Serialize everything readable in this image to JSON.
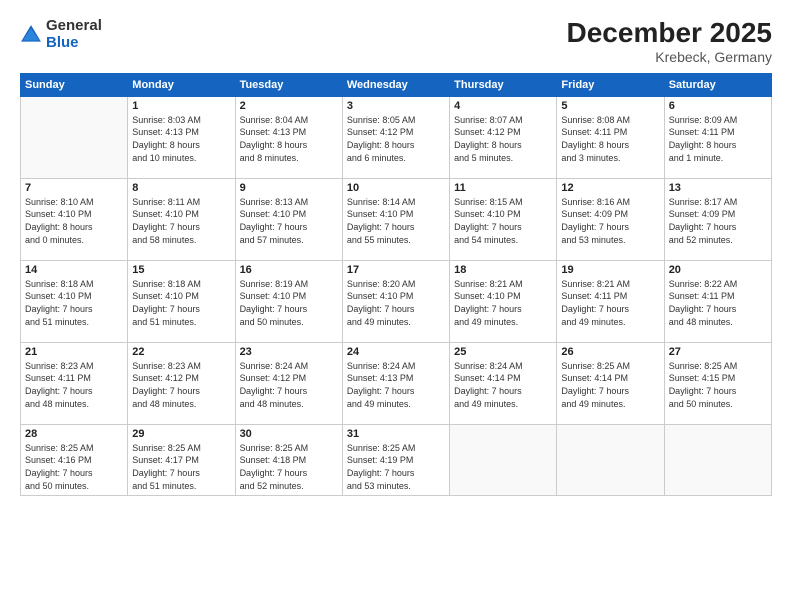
{
  "logo": {
    "general": "General",
    "blue": "Blue"
  },
  "title": "December 2025",
  "location": "Krebeck, Germany",
  "days_header": [
    "Sunday",
    "Monday",
    "Tuesday",
    "Wednesday",
    "Thursday",
    "Friday",
    "Saturday"
  ],
  "weeks": [
    [
      {
        "num": "",
        "info": ""
      },
      {
        "num": "1",
        "info": "Sunrise: 8:03 AM\nSunset: 4:13 PM\nDaylight: 8 hours\nand 10 minutes."
      },
      {
        "num": "2",
        "info": "Sunrise: 8:04 AM\nSunset: 4:13 PM\nDaylight: 8 hours\nand 8 minutes."
      },
      {
        "num": "3",
        "info": "Sunrise: 8:05 AM\nSunset: 4:12 PM\nDaylight: 8 hours\nand 6 minutes."
      },
      {
        "num": "4",
        "info": "Sunrise: 8:07 AM\nSunset: 4:12 PM\nDaylight: 8 hours\nand 5 minutes."
      },
      {
        "num": "5",
        "info": "Sunrise: 8:08 AM\nSunset: 4:11 PM\nDaylight: 8 hours\nand 3 minutes."
      },
      {
        "num": "6",
        "info": "Sunrise: 8:09 AM\nSunset: 4:11 PM\nDaylight: 8 hours\nand 1 minute."
      }
    ],
    [
      {
        "num": "7",
        "info": "Sunrise: 8:10 AM\nSunset: 4:10 PM\nDaylight: 8 hours\nand 0 minutes."
      },
      {
        "num": "8",
        "info": "Sunrise: 8:11 AM\nSunset: 4:10 PM\nDaylight: 7 hours\nand 58 minutes."
      },
      {
        "num": "9",
        "info": "Sunrise: 8:13 AM\nSunset: 4:10 PM\nDaylight: 7 hours\nand 57 minutes."
      },
      {
        "num": "10",
        "info": "Sunrise: 8:14 AM\nSunset: 4:10 PM\nDaylight: 7 hours\nand 55 minutes."
      },
      {
        "num": "11",
        "info": "Sunrise: 8:15 AM\nSunset: 4:10 PM\nDaylight: 7 hours\nand 54 minutes."
      },
      {
        "num": "12",
        "info": "Sunrise: 8:16 AM\nSunset: 4:09 PM\nDaylight: 7 hours\nand 53 minutes."
      },
      {
        "num": "13",
        "info": "Sunrise: 8:17 AM\nSunset: 4:09 PM\nDaylight: 7 hours\nand 52 minutes."
      }
    ],
    [
      {
        "num": "14",
        "info": "Sunrise: 8:18 AM\nSunset: 4:10 PM\nDaylight: 7 hours\nand 51 minutes."
      },
      {
        "num": "15",
        "info": "Sunrise: 8:18 AM\nSunset: 4:10 PM\nDaylight: 7 hours\nand 51 minutes."
      },
      {
        "num": "16",
        "info": "Sunrise: 8:19 AM\nSunset: 4:10 PM\nDaylight: 7 hours\nand 50 minutes."
      },
      {
        "num": "17",
        "info": "Sunrise: 8:20 AM\nSunset: 4:10 PM\nDaylight: 7 hours\nand 49 minutes."
      },
      {
        "num": "18",
        "info": "Sunrise: 8:21 AM\nSunset: 4:10 PM\nDaylight: 7 hours\nand 49 minutes."
      },
      {
        "num": "19",
        "info": "Sunrise: 8:21 AM\nSunset: 4:11 PM\nDaylight: 7 hours\nand 49 minutes."
      },
      {
        "num": "20",
        "info": "Sunrise: 8:22 AM\nSunset: 4:11 PM\nDaylight: 7 hours\nand 48 minutes."
      }
    ],
    [
      {
        "num": "21",
        "info": "Sunrise: 8:23 AM\nSunset: 4:11 PM\nDaylight: 7 hours\nand 48 minutes."
      },
      {
        "num": "22",
        "info": "Sunrise: 8:23 AM\nSunset: 4:12 PM\nDaylight: 7 hours\nand 48 minutes."
      },
      {
        "num": "23",
        "info": "Sunrise: 8:24 AM\nSunset: 4:12 PM\nDaylight: 7 hours\nand 48 minutes."
      },
      {
        "num": "24",
        "info": "Sunrise: 8:24 AM\nSunset: 4:13 PM\nDaylight: 7 hours\nand 49 minutes."
      },
      {
        "num": "25",
        "info": "Sunrise: 8:24 AM\nSunset: 4:14 PM\nDaylight: 7 hours\nand 49 minutes."
      },
      {
        "num": "26",
        "info": "Sunrise: 8:25 AM\nSunset: 4:14 PM\nDaylight: 7 hours\nand 49 minutes."
      },
      {
        "num": "27",
        "info": "Sunrise: 8:25 AM\nSunset: 4:15 PM\nDaylight: 7 hours\nand 50 minutes."
      }
    ],
    [
      {
        "num": "28",
        "info": "Sunrise: 8:25 AM\nSunset: 4:16 PM\nDaylight: 7 hours\nand 50 minutes."
      },
      {
        "num": "29",
        "info": "Sunrise: 8:25 AM\nSunset: 4:17 PM\nDaylight: 7 hours\nand 51 minutes."
      },
      {
        "num": "30",
        "info": "Sunrise: 8:25 AM\nSunset: 4:18 PM\nDaylight: 7 hours\nand 52 minutes."
      },
      {
        "num": "31",
        "info": "Sunrise: 8:25 AM\nSunset: 4:19 PM\nDaylight: 7 hours\nand 53 minutes."
      },
      {
        "num": "",
        "info": ""
      },
      {
        "num": "",
        "info": ""
      },
      {
        "num": "",
        "info": ""
      }
    ]
  ]
}
